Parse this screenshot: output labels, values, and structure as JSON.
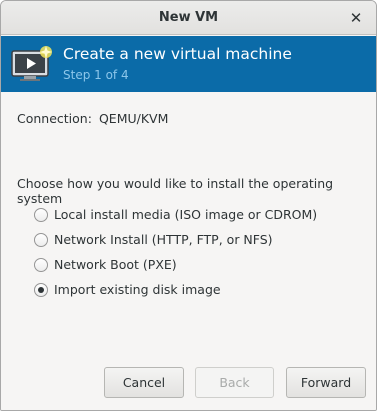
{
  "window": {
    "title": "New VM"
  },
  "header": {
    "title": "Create a new virtual machine",
    "step": "Step 1 of 4"
  },
  "connection": {
    "label": "Connection:",
    "value": "QEMU/KVM"
  },
  "install": {
    "question": "Choose how you would like to install the operating system",
    "options": [
      {
        "label": "Local install media (ISO image or CDROM)",
        "selected": false
      },
      {
        "label": "Network Install (HTTP, FTP, or NFS)",
        "selected": false
      },
      {
        "label": "Network Boot (PXE)",
        "selected": false
      },
      {
        "label": "Import existing disk image",
        "selected": true
      }
    ]
  },
  "buttons": {
    "cancel": "Cancel",
    "back": "Back",
    "forward": "Forward"
  },
  "colors": {
    "banner": "#0b6ba8",
    "step_text": "#8cc6ea"
  },
  "icons": {
    "header": "monitor-with-play-and-star-icon",
    "close": "close-icon"
  }
}
